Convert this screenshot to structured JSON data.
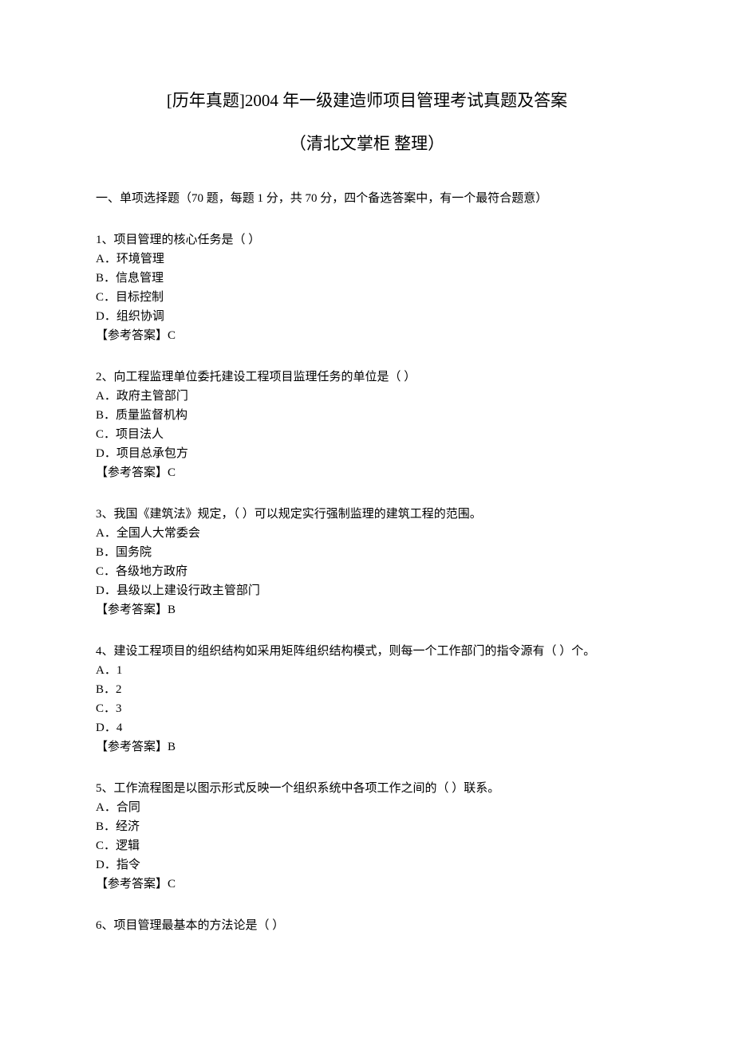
{
  "title": "[历年真题]2004 年一级建造师项目管理考试真题及答案",
  "subtitle": "（清北文掌柜  整理）",
  "section_instruction": "一、单项选择题（70 题，每题 1 分，共 70 分，四个备选答案中，有一个最符合题意）",
  "questions": [
    {
      "stem": "1、项目管理的核心任务是（ ）",
      "options": [
        "A．环境管理",
        "B．信息管理",
        "C．目标控制",
        "D．组织协调"
      ],
      "answer": "【参考答案】C"
    },
    {
      "stem": "2、向工程监理单位委托建设工程项目监理任务的单位是（ ）",
      "options": [
        "A．政府主管部门",
        "B．质量监督机构",
        "C．项目法人",
        "D．项目总承包方"
      ],
      "answer": "【参考答案】C"
    },
    {
      "stem": "3、我国《建筑法》规定，（ ）可以规定实行强制监理的建筑工程的范围。",
      "options": [
        "A．全国人大常委会",
        "B．国务院",
        "C．各级地方政府",
        "D．县级以上建设行政主管部门"
      ],
      "answer": "【参考答案】B"
    },
    {
      "stem": "4、建设工程项目的组织结构如采用矩阵组织结构模式，则每一个工作部门的指令源有（ ）个。",
      "options": [
        "A．1",
        "B．2",
        "C．3",
        "D．4"
      ],
      "answer": "【参考答案】B"
    },
    {
      "stem": "5、工作流程图是以图示形式反映一个组织系统中各项工作之间的（ ）联系。",
      "options": [
        "A．合同",
        "B．经济",
        "C．逻辑",
        "D．指令"
      ],
      "answer": "【参考答案】C"
    },
    {
      "stem": "6、项目管理最基本的方法论是（ ）",
      "options": [],
      "answer": ""
    }
  ]
}
